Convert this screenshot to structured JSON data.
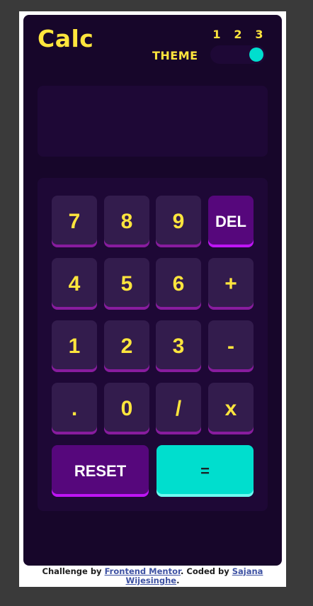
{
  "app": {
    "title": "Calc",
    "theme": {
      "label": "THEME",
      "options": [
        "1",
        "2",
        "3"
      ],
      "selected": "3"
    },
    "display": {
      "value": ""
    },
    "keys": {
      "k7": "7",
      "k8": "8",
      "k9": "9",
      "del": "DEL",
      "k4": "4",
      "k5": "5",
      "k6": "6",
      "plus": "+",
      "k1": "1",
      "k2": "2",
      "k3": "3",
      "minus": "-",
      "dot": ".",
      "k0": "0",
      "divide": "/",
      "multiply": "x",
      "reset": "RESET",
      "equals": "="
    }
  },
  "footer": {
    "challenge_prefix": "Challenge by ",
    "challenge_link": "Frontend Mentor",
    "coded_prefix": ". Coded by ",
    "coded_link": "Sajana Wijesinghe",
    "suffix": "."
  },
  "colors": {
    "background": "#17062a",
    "panel": "#1e0836",
    "key": "#331c4d",
    "key_text": "#ffe53d",
    "function_key": "#56077c",
    "accent": "#00dece"
  }
}
